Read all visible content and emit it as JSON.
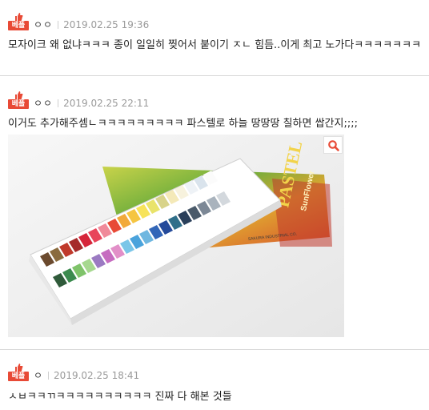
{
  "comments": [
    {
      "badge": "베플",
      "author": "ㅇㅇ",
      "date": "2019.02.25 19:36",
      "text": "모자이크 왜 없냐ㅋㅋㅋ 종이 일일히 찢어서 붙이기 ㅈㄴ 힘듬..이게 최고 노가다ㅋㅋㅋㅋㅋㅋㅋ"
    },
    {
      "badge": "베플",
      "author": "ㅇㅇ",
      "date": "2019.02.25 22:11",
      "text": "이거도 추가해주셈ㄴㅋㅋㅋㅋㅋㅋㅋㅋㅋ 파스텔로 하늘 땅땅땅 칠하면 쌉간지;;;;",
      "image": {
        "subject": "pastel-set",
        "box_brand": "PASTEL",
        "box_maker": "SunFlower",
        "box_subtext": "SAKURA INDUSTRIAL CO."
      }
    },
    {
      "badge": "베플",
      "author": "ㅇ",
      "date": "2019.02.25 18:41",
      "text": "ㅅㅂㅋㅋㄲㅋㅋㅋㅋㅋㅋㅋㅋㅋㅋ 진짜 다 해본 것들"
    }
  ],
  "colors": {
    "badge_bg": "#e84a36",
    "date_text": "#9a9a9a",
    "divider": "#d9d9d9"
  },
  "icons": {
    "badge": "thumbs-up-icon",
    "zoom": "magnifier-icon"
  }
}
